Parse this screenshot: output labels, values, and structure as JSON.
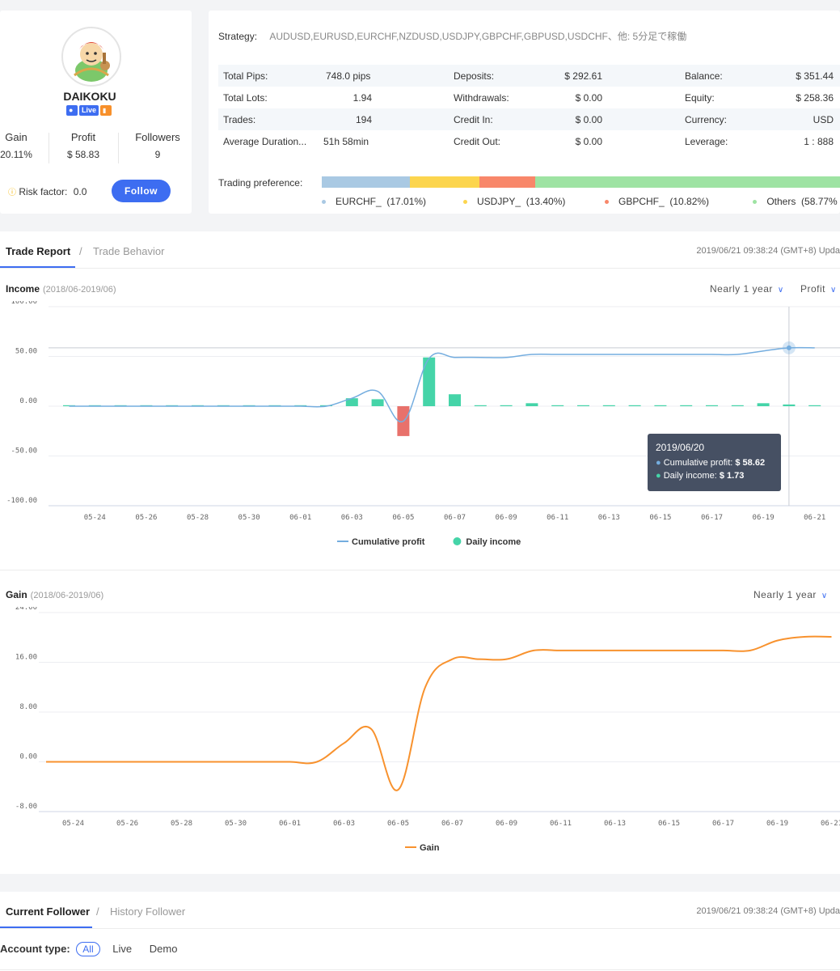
{
  "profile": {
    "name": "DAIKOKU",
    "badge_live": "Live",
    "stats": [
      {
        "label": "Gain",
        "value": "20.11%"
      },
      {
        "label": "Profit",
        "value": "$ 58.83"
      },
      {
        "label": "Followers",
        "value": "9"
      }
    ],
    "risk_label": "Risk factor:",
    "risk_value": "0.0",
    "follow_label": "Follow"
  },
  "info": {
    "strategy_label": "Strategy:",
    "strategy_value": "AUDUSD,EURUSD,EURCHF,NZDUSD,USDJPY,GBPCHF,GBPUSD,USDCHF、他: 5分足で稼働",
    "rows": [
      [
        "Total Pips:",
        "748.0 pips",
        "Deposits:",
        "$ 292.61",
        "Balance:",
        "$ 351.44"
      ],
      [
        "Total Lots:",
        "1.94",
        "Withdrawals:",
        "$ 0.00",
        "Equity:",
        "$ 258.36"
      ],
      [
        "Trades:",
        "194",
        "Credit In:",
        "$ 0.00",
        "Currency:",
        "USD"
      ],
      [
        "Average Duration...",
        "51h 58min",
        "Credit Out:",
        "$ 0.00",
        "Leverage:",
        "1 : 888"
      ]
    ],
    "pref_label": "Trading preference:",
    "preferences": [
      {
        "name": "EURCHF_",
        "pct": "(17.01%)",
        "share": 17.01,
        "color": "#a9c9e3"
      },
      {
        "name": "USDJPY_",
        "pct": "(13.40%)",
        "share": 13.4,
        "color": "#fcd54e"
      },
      {
        "name": "GBPCHF_",
        "pct": "(10.82%)",
        "share": 10.82,
        "color": "#f8876a"
      },
      {
        "name": "Others",
        "pct": "(58.77%",
        "share": 58.77,
        "color": "#9ee3a3"
      }
    ]
  },
  "report": {
    "tab_active": "Trade Report",
    "tab_sep": "/",
    "tab_inactive": "Trade Behavior",
    "updated": "2019/06/21 09:38:24  (GMT+8)  Upda",
    "income_title": "Income",
    "income_range": "(2018/06-2019/06)",
    "dd_period": "Nearly 1 year",
    "dd_metric": "Profit",
    "gain_title": "Gain",
    "gain_range": "(2018/06-2019/06)",
    "gain_dd_period": "Nearly 1 year",
    "tooltip": {
      "date": "2019/06/20",
      "cum_label": "Cumulative profit:",
      "cum_value": "$ 58.62",
      "daily_label": "Daily income:",
      "daily_value": "$ 1.73"
    }
  },
  "follower": {
    "tab_active": "Current Follower",
    "tab_sep": "/",
    "tab_inactive": "History Follower",
    "updated": "2019/06/21 09:38:24  (GMT+8)  Upda",
    "account_label": "Account type:",
    "options": [
      "All",
      "Live",
      "Demo"
    ]
  },
  "chart_data": [
    {
      "type": "bar",
      "title": "Income",
      "subtitle": "(2018/06-2019/06)",
      "x_ticks": [
        "05-24",
        "05-26",
        "05-28",
        "05-30",
        "06-01",
        "06-03",
        "06-05",
        "06-07",
        "06-09",
        "06-11",
        "06-13",
        "06-15",
        "06-17",
        "06-19",
        "06-21"
      ],
      "y_ticks": [
        "100.00",
        "50.00",
        "0.00",
        "-50.00",
        "-100.00"
      ],
      "ylim": [
        -100,
        100
      ],
      "x": [
        "05-23",
        "05-24",
        "05-25",
        "05-26",
        "05-27",
        "05-28",
        "05-29",
        "05-30",
        "05-31",
        "06-01",
        "06-02",
        "06-03",
        "06-04",
        "06-05",
        "06-06",
        "06-07",
        "06-08",
        "06-09",
        "06-10",
        "06-11",
        "06-12",
        "06-13",
        "06-14",
        "06-15",
        "06-16",
        "06-17",
        "06-18",
        "06-19",
        "06-20",
        "06-21"
      ],
      "series": [
        {
          "name": "Daily income",
          "kind": "bar",
          "color": "#45d4a8",
          "values": [
            0,
            0,
            0,
            0,
            0,
            0,
            0,
            0,
            0,
            0,
            0,
            8,
            7,
            -30,
            49,
            12,
            0,
            0,
            3,
            0,
            0,
            0,
            0,
            0,
            0,
            0,
            0,
            3,
            1.73,
            0
          ]
        },
        {
          "name": "Cumulative profit",
          "kind": "line",
          "color": "#74addf",
          "values": [
            0,
            0,
            0,
            0,
            0,
            0,
            0,
            0,
            0,
            0,
            0,
            8,
            15,
            -15,
            48,
            49,
            49,
            49,
            52,
            52,
            52,
            52,
            52,
            52,
            52,
            52,
            52,
            55.5,
            58.62,
            58.62
          ]
        }
      ],
      "legend": "bottom"
    },
    {
      "type": "line",
      "title": "Gain",
      "subtitle": "(2018/06-2019/06)",
      "x_ticks": [
        "05-24",
        "05-26",
        "05-28",
        "05-30",
        "06-01",
        "06-03",
        "06-05",
        "06-07",
        "06-09",
        "06-11",
        "06-13",
        "06-15",
        "06-17",
        "06-19",
        "06-21"
      ],
      "y_ticks": [
        "24.00",
        "16.00",
        "8.00",
        "0.00",
        "-8.00"
      ],
      "ylim": [
        -8,
        24
      ],
      "x": [
        "05-23",
        "05-24",
        "05-25",
        "05-26",
        "05-27",
        "05-28",
        "05-29",
        "05-30",
        "05-31",
        "06-01",
        "06-02",
        "06-03",
        "06-04",
        "06-05",
        "06-06",
        "06-07",
        "06-08",
        "06-09",
        "06-10",
        "06-11",
        "06-12",
        "06-13",
        "06-14",
        "06-15",
        "06-16",
        "06-17",
        "06-18",
        "06-19",
        "06-20",
        "06-21"
      ],
      "series": [
        {
          "name": "Gain",
          "color": "#f8922e",
          "values": [
            0,
            0,
            0,
            0,
            0,
            0,
            0,
            0,
            0,
            0,
            0,
            3,
            5.3,
            -4.5,
            12,
            16.5,
            16.5,
            16.5,
            17.9,
            17.9,
            17.9,
            17.9,
            17.9,
            17.9,
            17.9,
            17.9,
            17.9,
            19.5,
            20.1,
            20.1
          ]
        }
      ],
      "legend": "bottom"
    }
  ]
}
